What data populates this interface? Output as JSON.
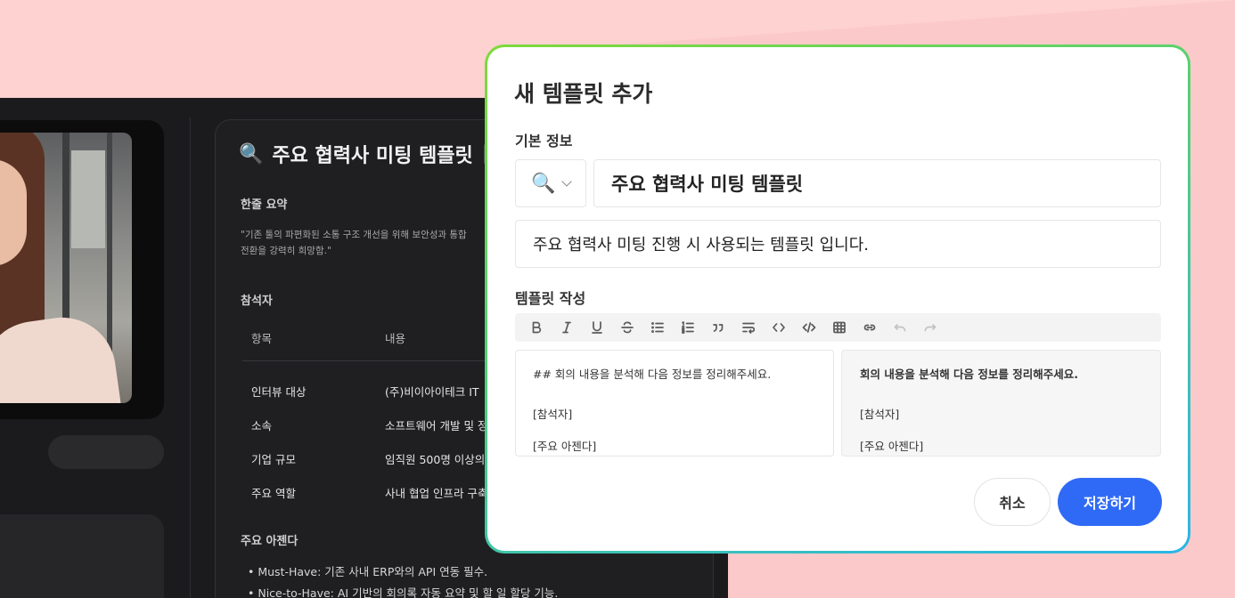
{
  "colors": {
    "background": "#ffd2d2",
    "dark_panel": "#1b1b1d",
    "modal_border_gradient": [
      "#7fd93a",
      "#2bb6e8"
    ],
    "primary_button": "#2f6af6"
  },
  "meeting_card": {
    "icon": "magnifier-emoji",
    "title_emoji": "🔍",
    "title": "주요 협력사 미팅 템플릿",
    "summary_label": "한줄 요약",
    "summary_quote_line1": "\"기존 툴의 파편화된 소통 구조 개선을 위해 보안성과 통합 ",
    "summary_quote_line2": "전환을 강력히 희망함.\"",
    "attendees_label": "참석자",
    "table_headers": {
      "item": "항목",
      "content": "내용"
    },
    "rows": [
      {
        "key": "인터뷰 대상",
        "value": "(주)비이아이테크 IT"
      },
      {
        "key": "소속",
        "value": "소프트웨어 개발 및 정"
      },
      {
        "key": "기업 규모",
        "value": "임직원 500명 이상의"
      },
      {
        "key": "주요 역할",
        "value": "사내 협업 인프라 구축"
      }
    ],
    "agenda_label": "주요 아젠다",
    "agenda_items": [
      "• Must-Have: 기존 사내 ERP와의 API 연동 필수.",
      "• Nice-to-Have: AI 기반의 회의록 자동 요약 및 할 일 할당 기능."
    ]
  },
  "modal": {
    "title": "새 템플릿 추가",
    "basic_info_label": "기본 정보",
    "emoji_value": "🔍",
    "emoji_icon": "magnifier-emoji",
    "name_value": "주요 협력사 미팅 템플릿",
    "description_value": "주요 협력사 미팅 진행 시 사용되는 템플릿 입니다.",
    "compose_label": "템플릿 작성",
    "toolbar": [
      {
        "name": "bold-icon",
        "label": "B"
      },
      {
        "name": "italic-icon",
        "label": "I"
      },
      {
        "name": "underline-icon",
        "label": "U"
      },
      {
        "name": "strikethrough-icon",
        "label": "S"
      },
      {
        "name": "bullet-list-icon"
      },
      {
        "name": "ordered-list-icon"
      },
      {
        "name": "quote-icon"
      },
      {
        "name": "wrap-text-icon"
      },
      {
        "name": "code-icon"
      },
      {
        "name": "code-block-icon"
      },
      {
        "name": "table-icon"
      },
      {
        "name": "link-icon"
      },
      {
        "name": "undo-icon"
      },
      {
        "name": "redo-icon"
      }
    ],
    "editor_lines": [
      "## 회의 내용을 분석해 다음 정보를 정리해주세요.",
      "[참석자]",
      "[주요 아젠다]"
    ],
    "preview_lines": [
      "회의 내용을 분석해 다음 정보를 정리해주세요.",
      "[참석자]",
      "[주요 아젠다]"
    ],
    "cancel_label": "취소",
    "save_label": "저장하기"
  }
}
